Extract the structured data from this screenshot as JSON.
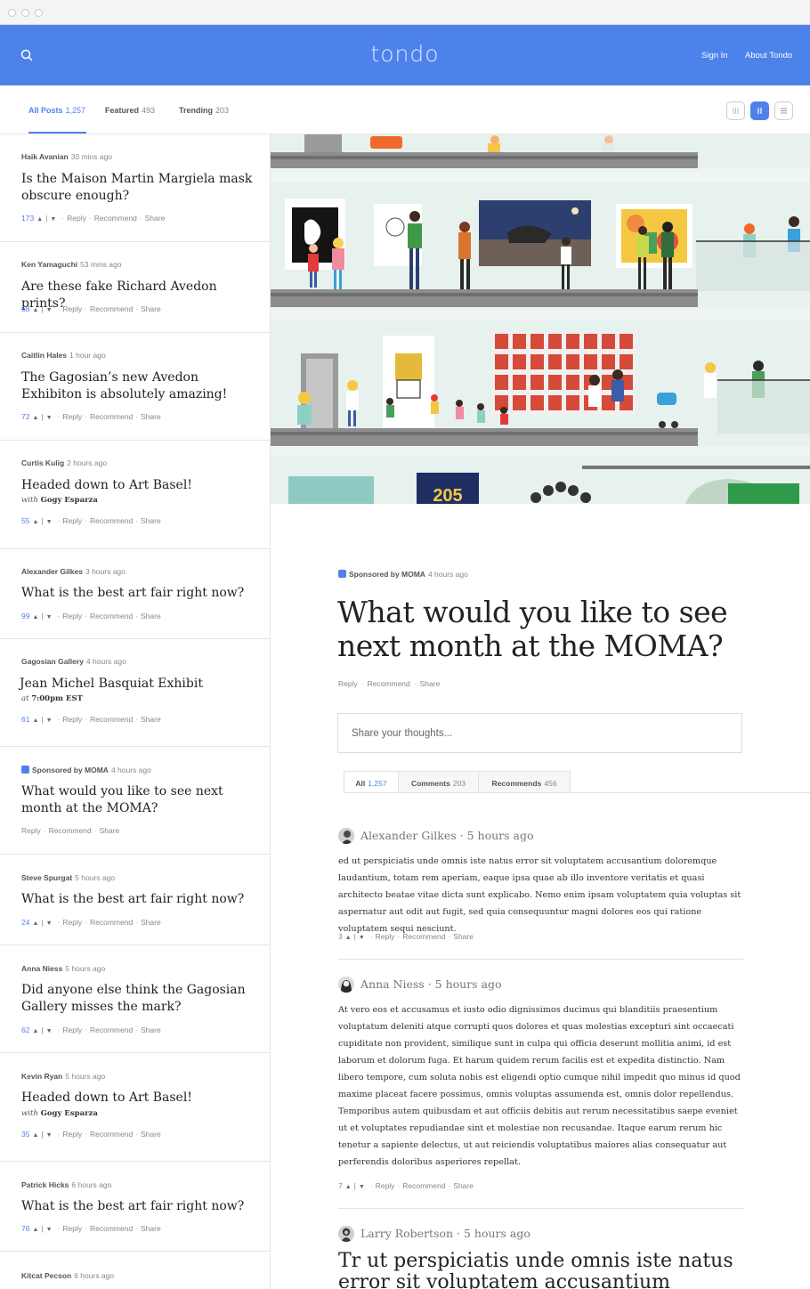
{
  "header": {
    "logo": "tondo",
    "sign_in": "Sign In",
    "about": "About Tondo",
    "search_icon": "search-icon",
    "brand_color": "#4e82eb"
  },
  "tabs": {
    "all": {
      "label": "All Posts",
      "count": "1,257"
    },
    "featured": {
      "label": "Featured",
      "count": "493"
    },
    "trending": {
      "label": "Trending",
      "count": "203"
    },
    "views": [
      "grid-view-icon",
      "column-view-icon",
      "list-view-icon"
    ],
    "active_view": "column-view-icon"
  },
  "posts": [
    {
      "author": "Haik Avanian",
      "time": "30 mins ago",
      "title": "Is the Maison Martin Margiela mask obscure enough?",
      "votes": "173",
      "reply": "Reply",
      "recommend": "Recommend",
      "share": "Share"
    },
    {
      "author": "Ken Yamaguchi",
      "time": "53 mins ago",
      "title": "Are these fake Richard Avedon prints?",
      "votes": "68",
      "reply": "Reply",
      "recommend": "Recommend",
      "share": "Share"
    },
    {
      "author": "Caitlin Hales",
      "time": "1 hour ago",
      "title": "The Gagosian’s new Avedon Exhibiton is absolutely amazing!",
      "votes": "72",
      "reply": "Reply",
      "recommend": "Recommend",
      "share": "Share"
    },
    {
      "author": "Curtis Kulig",
      "time": "2 hours ago",
      "title": "Headed down to Art Basel!",
      "sub_prefix": "with",
      "sub_name": "Gogy Esparza",
      "votes": "55",
      "reply": "Reply",
      "recommend": "Recommend",
      "share": "Share"
    },
    {
      "author": "Alexander Gilkes",
      "time": "3 hours ago",
      "title": "What is the best art fair right now?",
      "votes": "99",
      "reply": "Reply",
      "recommend": "Recommend",
      "share": "Share"
    },
    {
      "author": "Gagosian Gallery",
      "time": "4 hours ago",
      "title": "Jean Michel Basquiat Exhibit",
      "sub_prefix": "at",
      "sub_name": "7:00pm EST",
      "votes": "61",
      "reply": "Reply",
      "recommend": "Recommend",
      "share": "Share"
    },
    {
      "author": "Sponsored by MOMA",
      "time": "4 hours ago",
      "title": "What would you like to see next month at the MOMA?",
      "reply": "Reply",
      "recommend": "Recommend",
      "share": "Share"
    },
    {
      "author": "Steve Spurgat",
      "time": "5 hours ago",
      "title": "What is the best art fair right now?",
      "votes": "24",
      "reply": "Reply",
      "recommend": "Recommend",
      "share": "Share"
    },
    {
      "author": "Anna Niess",
      "time": "5 hours ago",
      "title": "Did anyone else think the Gagosian Gallery misses the mark?",
      "votes": "62",
      "reply": "Reply",
      "recommend": "Recommend",
      "share": "Share"
    },
    {
      "author": "Kevin Ryan",
      "time": "5 hours ago",
      "title": "Headed down to Art Basel!",
      "sub_prefix": "with",
      "sub_name": "Gogy Esparza",
      "votes": "35",
      "reply": "Reply",
      "recommend": "Recommend",
      "share": "Share"
    },
    {
      "author": "Patrick Hicks",
      "time": "6 hours ago",
      "title": "What is the best art fair right now?",
      "votes": "76",
      "reply": "Reply",
      "recommend": "Recommend",
      "share": "Share"
    },
    {
      "author": "Kitcat Pecson",
      "time": "6 hours ago"
    }
  ],
  "hero": {
    "numeral": "205"
  },
  "article": {
    "sponsor": "Sponsored by MOMA",
    "time": "4 hours ago",
    "title": "What would you like to see next month at the MOMA?",
    "reply": "Reply",
    "recommend": "Recommend",
    "share": "Share",
    "input_placeholder": "Share your thoughts..."
  },
  "comment_tabs": [
    {
      "label": "All",
      "count": "1,257"
    },
    {
      "label": "Comments",
      "count": "203"
    },
    {
      "label": "Recommends",
      "count": "456"
    }
  ],
  "comments": [
    {
      "author": "Alexander Gilkes",
      "time": "5 hours ago",
      "body": "ed ut perspiciatis unde omnis iste natus error sit voluptatem accusantium doloremque laudantium, totam rem aperiam, eaque ipsa quae ab illo inventore veritatis et quasi architecto beatae vitae dicta sunt explicabo. Nemo enim ipsam voluptatem quia voluptas sit aspernatur aut odit aut fugit, sed quia consequuntur magni dolores eos qui ratione voluptatem sequi nesciunt.",
      "votes": "3",
      "reply": "Reply",
      "recommend": "Recommend",
      "share": "Share"
    },
    {
      "author": "Anna Niess",
      "time": "5 hours ago",
      "body": "At vero eos et accusamus et iusto odio dignissimos ducimus qui blanditiis praesentium voluptatum deleniti atque corrupti quos dolores et quas molestias excepturi sint occaecati cupiditate non provident, similique sunt in culpa qui officia deserunt mollitia animi, id est laborum et dolorum fuga. Et harum quidem rerum facilis est et expedita distinctio. Nam libero tempore, cum soluta nobis est eligendi optio cumque nihil impedit quo minus id quod maxime placeat facere possimus, omnis voluptas assumenda est, omnis dolor repellendus. Temporibus autem quibusdam et aut officiis debitis aut rerum necessitatibus saepe eveniet ut et voluptates repudiandae sint et molestiae non recusandae. Itaque earum rerum hic tenetur a sapiente delectus, ut aut reiciendis voluptatibus maiores alias consequatur aut perferendis doloribus asperiores repellat.",
      "votes": "7",
      "reply": "Reply",
      "recommend": "Recommend",
      "share": "Share"
    },
    {
      "author": "Larry Robertson",
      "time": "5 hours ago",
      "title": "Tr ut perspiciatis unde omnis iste natus error sit voluptatem accusantium dolorem"
    }
  ]
}
